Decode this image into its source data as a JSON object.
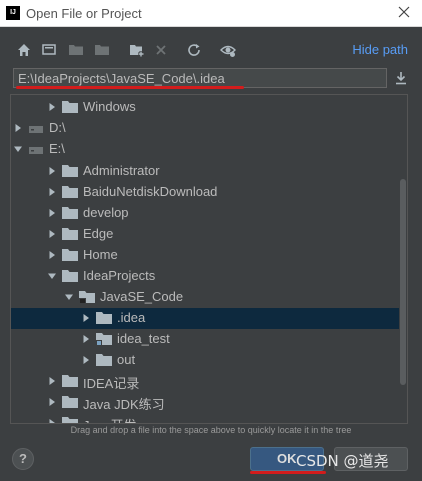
{
  "window": {
    "title": "Open File or Project",
    "app_icon_text": "IJ"
  },
  "toolbar": {
    "buttons": [
      "home-icon",
      "desktop-icon",
      "project-folder-icon",
      "module-folder-icon",
      "new-folder-icon",
      "delete-icon",
      "refresh-icon",
      "show-hidden-icon"
    ],
    "hide_path_label": "Hide path"
  },
  "path": {
    "value": "E:\\IdeaProjects\\JavaSE_Code\\.idea"
  },
  "tree": {
    "rows": [
      {
        "label": "Windows",
        "expanded": false,
        "type": "folder"
      },
      {
        "label": "D:\\",
        "expanded": false,
        "type": "drive"
      },
      {
        "label": "E:\\",
        "expanded": true,
        "type": "drive"
      },
      {
        "label": "Administrator",
        "expanded": false,
        "type": "folder"
      },
      {
        "label": "BaiduNetdiskDownload",
        "expanded": false,
        "type": "folder"
      },
      {
        "label": "develop",
        "expanded": false,
        "type": "folder"
      },
      {
        "label": "Edge",
        "expanded": false,
        "type": "folder"
      },
      {
        "label": "Home",
        "expanded": false,
        "type": "folder"
      },
      {
        "label": "IdeaProjects",
        "expanded": true,
        "type": "folder"
      },
      {
        "label": "JavaSE_Code",
        "expanded": true,
        "type": "project"
      },
      {
        "label": ".idea",
        "expanded": false,
        "type": "folder",
        "selected": true
      },
      {
        "label": "idea_test",
        "expanded": false,
        "type": "module"
      },
      {
        "label": "out",
        "expanded": false,
        "type": "folder"
      },
      {
        "label": "IDEA记录",
        "expanded": false,
        "type": "folder"
      },
      {
        "label": "Java JDK练习",
        "expanded": false,
        "type": "folder"
      },
      {
        "label": "Java开发",
        "expanded": false,
        "type": "folder"
      }
    ]
  },
  "hint": "Drag and drop a file into the space above to quickly locate it in the tree",
  "buttons": {
    "help_label": "?",
    "ok_label": "OK",
    "cancel_label": ""
  },
  "watermark": "CSDN @道尧",
  "colors": {
    "background": "#3c3f41",
    "selection": "#0d293e",
    "link": "#589df6",
    "folder": "#aeb9c0",
    "annotation_red": "#d21c1c",
    "ok_button": "#365880"
  }
}
